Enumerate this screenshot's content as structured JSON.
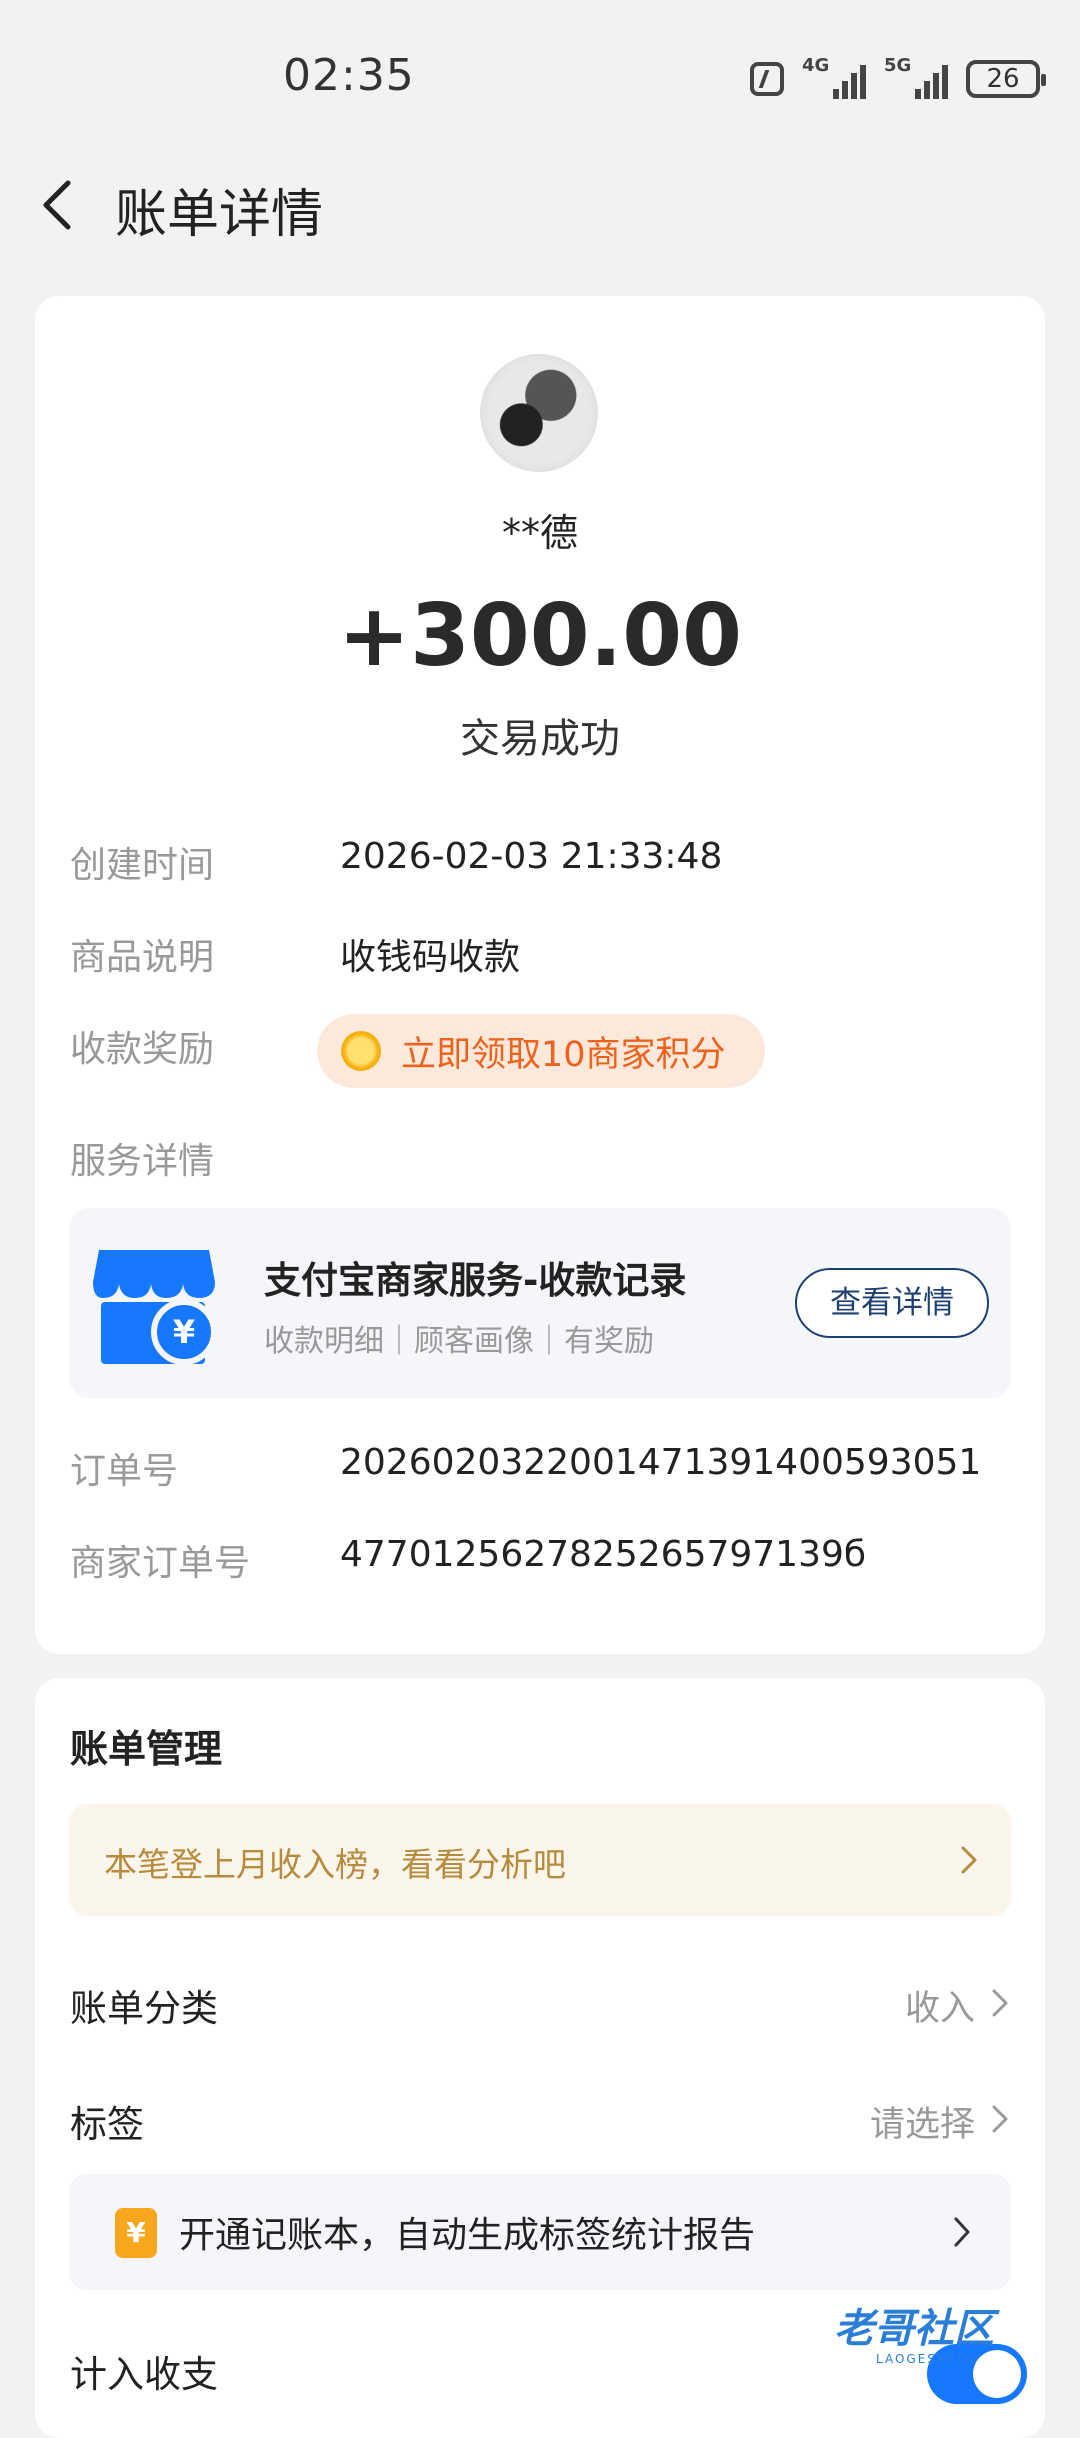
{
  "status_bar": {
    "time": "02:35",
    "signal1_label": "4G",
    "signal2_label": "5G",
    "battery": "26"
  },
  "header": {
    "title": "账单详情"
  },
  "transaction": {
    "payer": "**德",
    "amount": "+300.00",
    "status": "交易成功"
  },
  "details": {
    "created_label": "创建时间",
    "created_value": "2026-02-03 21:33:48",
    "product_label": "商品说明",
    "product_value": "收钱码收款",
    "reward_label": "收款奖励",
    "reward_pill": "立即领取10商家积分",
    "service_label": "服务详情",
    "order_label": "订单号",
    "order_value": "2026020322001471391400593051",
    "merchant_order_label": "商家订单号",
    "merchant_order_value": "4770125627825265797139б"
  },
  "service": {
    "title": "支付宝商家服务-收款记录",
    "subtitle": "收款明细｜顾客画像｜有奖励",
    "button": "查看详情"
  },
  "management": {
    "title": "账单管理",
    "tip": "本笔登上月收入榜，看看分析吧",
    "category_label": "账单分类",
    "category_value": "收入",
    "tag_label": "标签",
    "tag_value": "请选择",
    "book_icon": "¥",
    "book_text": "开通记账本，自动生成标签统计报告",
    "include_label": "计入收支",
    "include_on": true
  },
  "watermark": {
    "text": "老哥社区",
    "sub": "LAOGESHEQU"
  }
}
